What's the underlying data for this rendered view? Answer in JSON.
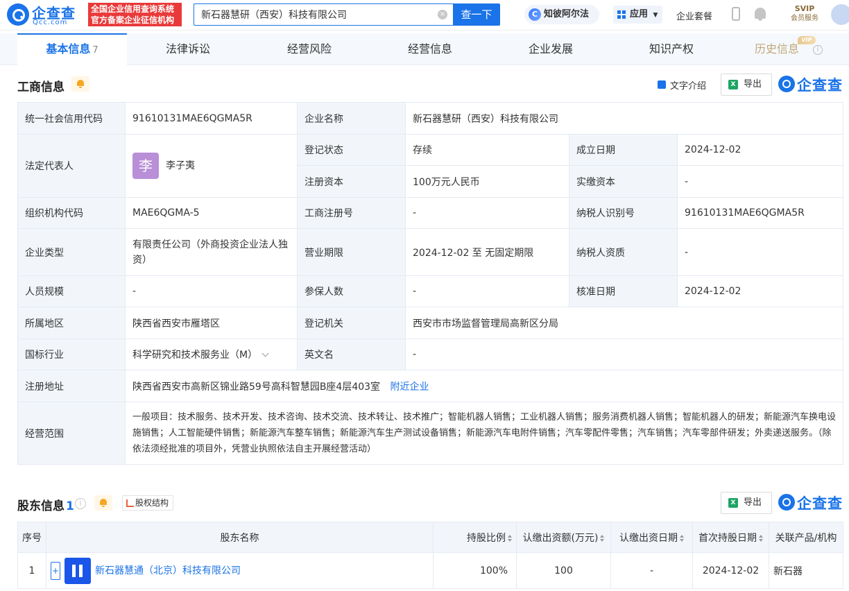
{
  "topbar": {
    "logo_text": "企查查",
    "logo_sub": "Qcc.com",
    "slogan_line1": "全国企业信用查询系统",
    "slogan_line2": "官方备案企业征信机构",
    "search_value": "新石器慧研（西安）科技有限公司",
    "search_button": "查一下",
    "ai_label": "知彼阿尔法",
    "app_label": "应用",
    "kit_label": "企业套餐",
    "svip_label": "SVIP",
    "member_label": "会员服务"
  },
  "tabs": [
    {
      "label": "基本信息",
      "count": "7"
    },
    {
      "label": "法律诉讼"
    },
    {
      "label": "经营风险"
    },
    {
      "label": "经营信息"
    },
    {
      "label": "企业发展"
    },
    {
      "label": "知识产权"
    },
    {
      "label": "历史信息",
      "badge": "VIP"
    }
  ],
  "business": {
    "title": "工商信息",
    "text_intro": "文字介绍",
    "export": "导出",
    "brand": "企查查",
    "credit_code_label": "统一社会信用代码",
    "credit_code": "91610131MAE6QGMA5R",
    "company_name_label": "企业名称",
    "company_name": "新石器慧研（西安）科技有限公司",
    "legal_rep_label": "法定代表人",
    "legal_rep_avatar": "李",
    "legal_rep": "李子夷",
    "reg_status_label": "登记状态",
    "reg_status": "存续",
    "found_date_label": "成立日期",
    "found_date": "2024-12-02",
    "reg_capital_label": "注册资本",
    "reg_capital": "100万元人民币",
    "paid_capital_label": "实缴资本",
    "paid_capital": "-",
    "org_code_label": "组织机构代码",
    "org_code": "MAE6QGMA-5",
    "biz_reg_no_label": "工商注册号",
    "biz_reg_no": "-",
    "taxpayer_id_label": "纳税人识别号",
    "taxpayer_id": "91610131MAE6QGMA5R",
    "company_type_label": "企业类型",
    "company_type": "有限责任公司（外商投资企业法人独资）",
    "biz_term_label": "营业期限",
    "biz_term": "2024-12-02 至 无固定期限",
    "taxpayer_qual_label": "纳税人资质",
    "taxpayer_qual": "-",
    "staff_size_label": "人员规模",
    "staff_size": "-",
    "insured_label": "参保人数",
    "insured": "-",
    "approve_date_label": "核准日期",
    "approve_date": "2024-12-02",
    "region_label": "所属地区",
    "region": "陕西省西安市雁塔区",
    "reg_authority_label": "登记机关",
    "reg_authority": "西安市市场监督管理局高新区分局",
    "industry_label": "国标行业",
    "industry": "科学研究和技术服务业（M）",
    "english_name_label": "英文名",
    "english_name": "-",
    "address_label": "注册地址",
    "address": "陕西省西安市高新区锦业路59号高科智慧园B座4层403室",
    "nearby_link": "附近企业",
    "scope_label": "经营范围",
    "scope": "一般项目：技术服务、技术开发、技术咨询、技术交流、技术转让、技术推广；智能机器人销售；工业机器人销售；服务消费机器人销售；智能机器人的研发；新能源汽车换电设施销售；人工智能硬件销售；新能源汽车整车销售；新能源汽车生产测试设备销售；新能源汽车电附件销售；汽车零配件零售；汽车销售；汽车零部件研发；外卖递送服务。（除依法须经批准的项目外，凭营业执照依法自主开展经营活动）"
  },
  "shareholders": {
    "title": "股东信息",
    "count": "1",
    "equity_btn": "股权结构",
    "export": "导出",
    "brand": "企查查",
    "headers": [
      "序号",
      "股东名称",
      "持股比例",
      "认缴出资额(万元)",
      "认缴出资日期",
      "首次持股日期",
      "关联产品/机构"
    ],
    "rows": [
      {
        "index": "1",
        "plus": "+",
        "name": "新石器慧通（北京）科技有限公司",
        "ratio": "100%",
        "amount": "100",
        "date": "-",
        "first_date": "2024-12-02",
        "product": "新石器"
      }
    ]
  }
}
